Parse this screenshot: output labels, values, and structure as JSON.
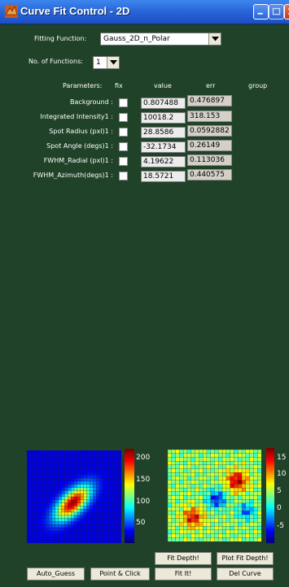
{
  "window": {
    "title": "Curve Fit Control - 2D",
    "buttons": {
      "minimize": "minimize-icon",
      "maximize": "maximize-icon",
      "close": "close-icon"
    }
  },
  "fitting_function": {
    "label": "Fitting Function:",
    "value": "Gauss_2D_n_Polar"
  },
  "num_functions": {
    "label": "No. of Functions:",
    "value": "1"
  },
  "headers": {
    "parameters": "Parameters:",
    "fix": "fix",
    "value": "value",
    "err": "err",
    "group": "group"
  },
  "parameters": [
    {
      "name": "Background :",
      "value": "0.807488",
      "err": "0.476897"
    },
    {
      "name": "Integrated Intensity1 :",
      "value": "10018.2",
      "err": "318.153"
    },
    {
      "name": "Spot Radius (pxl)1 :",
      "value": "28.8586",
      "err": "0.0592882"
    },
    {
      "name": "Spot Angle (degs)1 :",
      "value": "-32.1734",
      "err": "0.26149"
    },
    {
      "name": "FWHM_Radial (pxl)1 :",
      "value": "4.19622",
      "err": "0.113036"
    },
    {
      "name": "FWHM_Azimuth(degs)1 :",
      "value": "18.5721",
      "err": "0.440575"
    }
  ],
  "plots": {
    "left_colorbar_ticks": [
      "200",
      "150",
      "100",
      "50"
    ],
    "right_colorbar_ticks": [
      "15",
      "10",
      "5",
      "0",
      "-5"
    ],
    "colormap": "jet"
  },
  "buttons": {
    "auto_guess": "Auto_Guess",
    "point_click": "Point & Click",
    "fit_depth": "Fit Depth!",
    "plot_fit_depth": "Plot Fit Depth!",
    "fit_it": "Fit It!",
    "del_curve": "Del Curve"
  },
  "colors": {
    "background": "#1f4228",
    "titlebar": "#2a67d8"
  }
}
